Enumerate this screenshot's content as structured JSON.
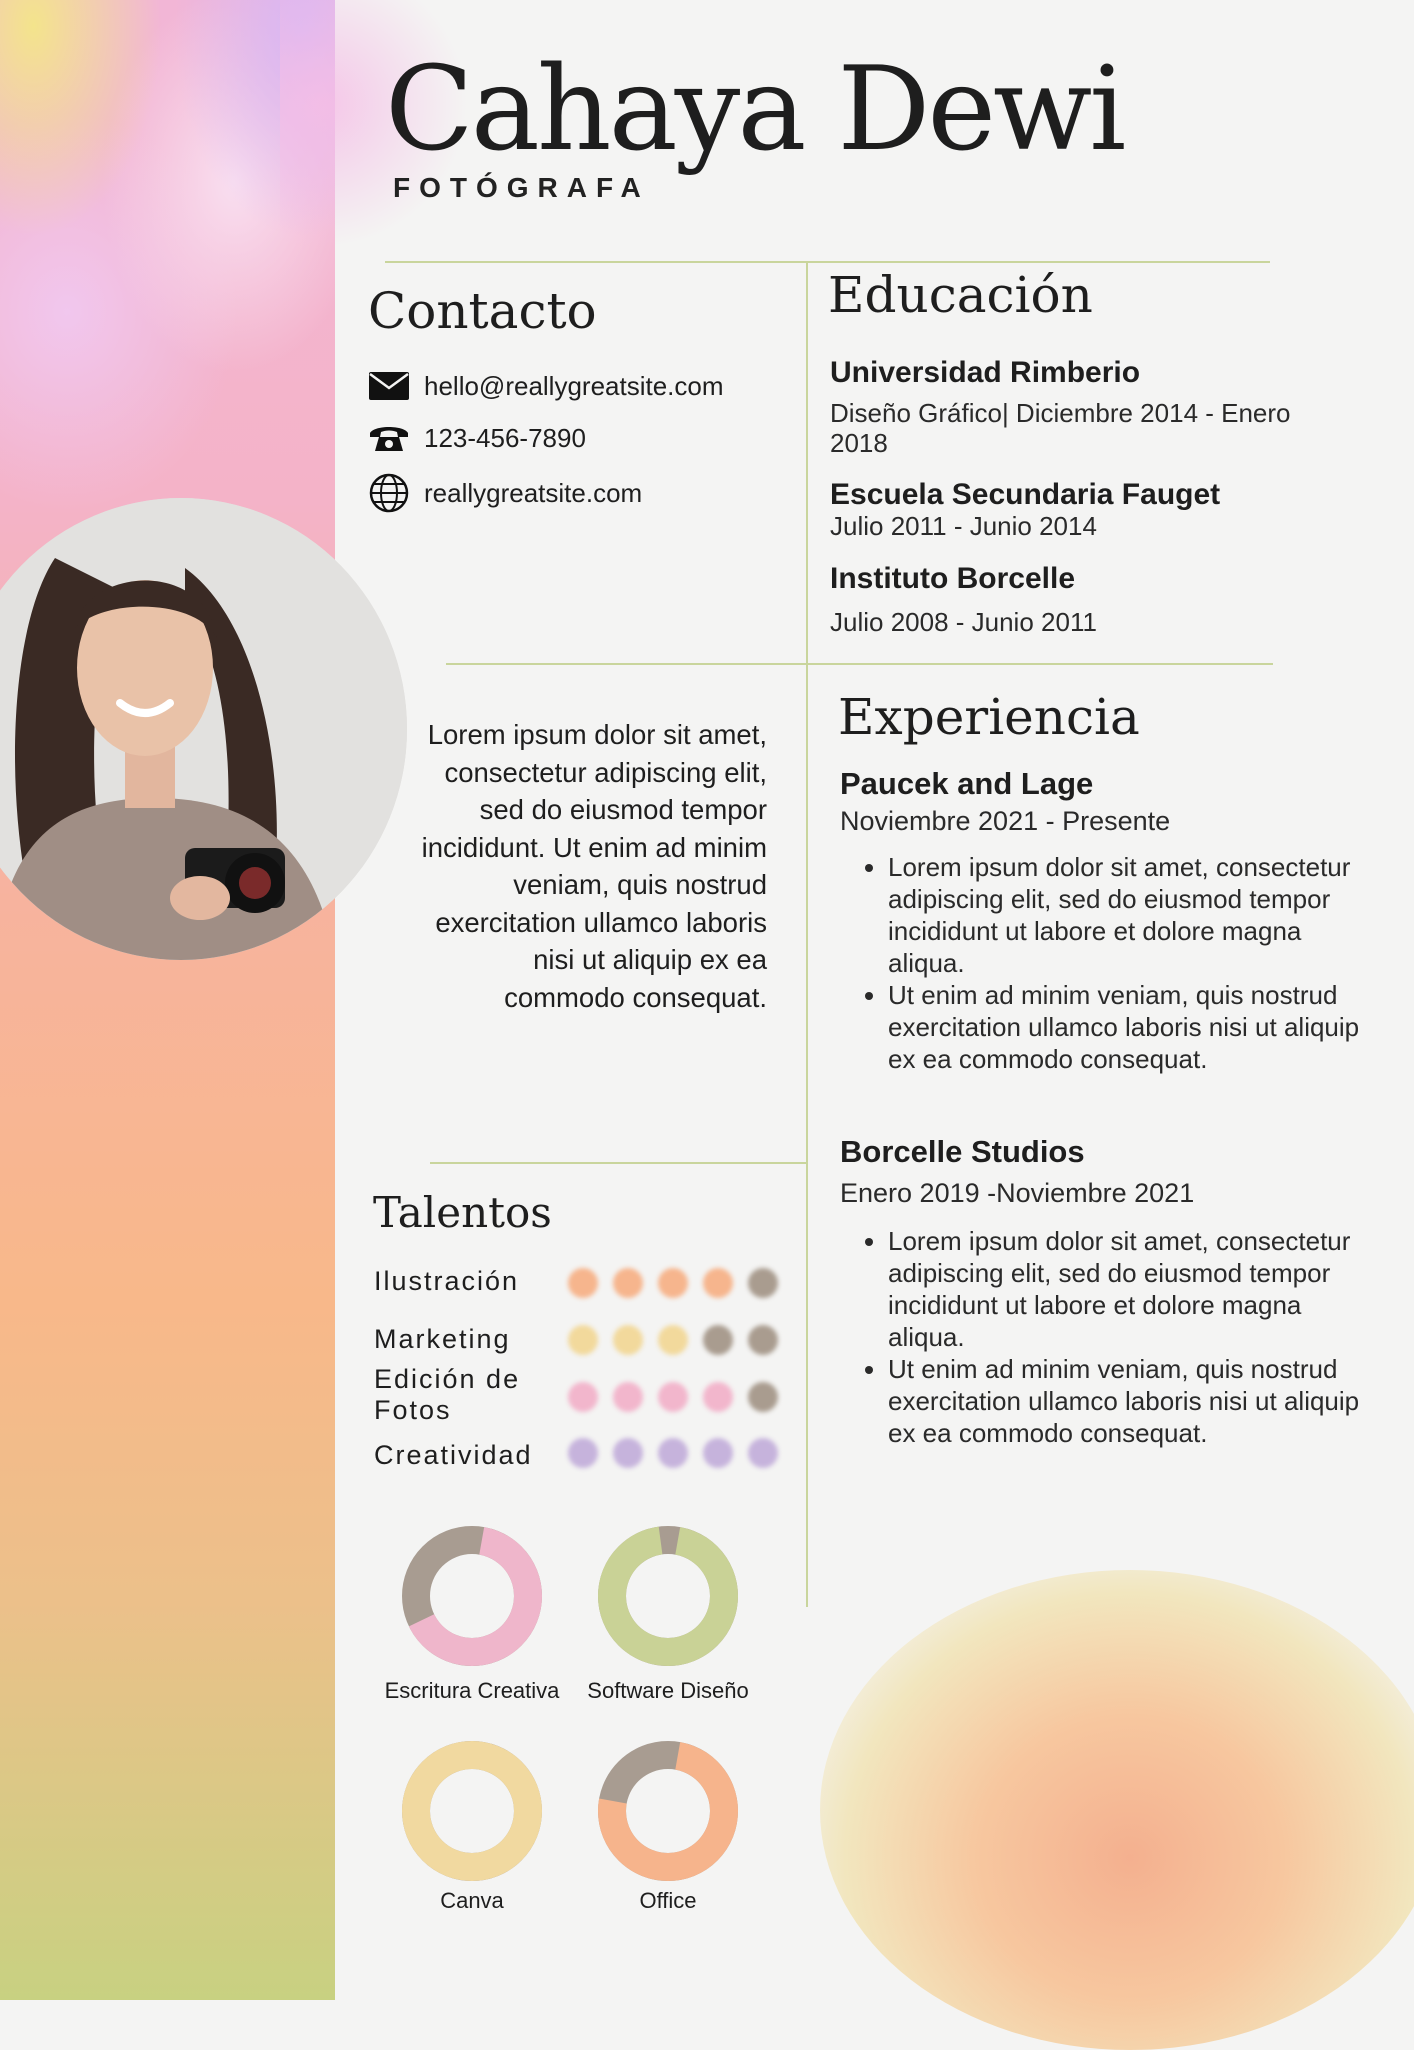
{
  "header": {
    "name": "Cahaya Dewi",
    "role": "FOTÓGRAFA"
  },
  "contact": {
    "title": "Contacto",
    "email": "hello@reallygreatsite.com",
    "phone": "123-456-7890",
    "website": "reallygreatsite.com",
    "icons": [
      "mail-icon",
      "phone-icon",
      "globe-icon"
    ]
  },
  "education": {
    "title": "Educación",
    "items": [
      {
        "school": "Universidad Rimberio",
        "detail": "Diseño Gráfico| Diciembre 2014 - Enero 2018"
      },
      {
        "school": "Escuela Secundaria Fauget",
        "detail": "Julio 2011 - Junio 2014"
      },
      {
        "school": "Instituto Borcelle",
        "detail": "Julio 2008 - Junio 2011"
      }
    ]
  },
  "about": {
    "text": "Lorem ipsum dolor sit amet, consectetur adipiscing elit, sed do eiusmod tempor incididunt. Ut enim ad minim veniam, quis nostrud exercitation ullamco laboris nisi ut aliquip ex ea commodo consequat."
  },
  "experience": {
    "title": "Experiencia",
    "jobs": [
      {
        "company": "Paucek and Lage",
        "dates": "Noviembre 2021 - Presente",
        "bullets": [
          "Lorem ipsum dolor sit amet, consectetur adipiscing elit, sed do eiusmod tempor incididunt ut labore et dolore magna aliqua.",
          "Ut enim ad minim veniam, quis nostrud exercitation ullamco laboris nisi ut aliquip ex ea commodo consequat."
        ]
      },
      {
        "company": "Borcelle Studios",
        "dates": "Enero 2019 -Noviembre 2021",
        "bullets": [
          "Lorem ipsum dolor sit amet, consectetur adipiscing elit, sed do eiusmod tempor incididunt ut labore et dolore magna aliqua.",
          "Ut enim ad minim veniam, quis nostrud exercitation ullamco laboris nisi ut aliquip ex ea commodo consequat."
        ]
      }
    ]
  },
  "talents": {
    "title": "Talentos",
    "dot_empty_color": "#a99c8f",
    "skills": [
      {
        "name": "Ilustración",
        "level": 4,
        "max": 5,
        "color": "#f6b58d"
      },
      {
        "name": "Marketing",
        "level": 3,
        "max": 5,
        "color": "#f2d99c"
      },
      {
        "name": "Edición de Fotos",
        "level": 4,
        "max": 5,
        "color": "#f2b6cc"
      },
      {
        "name": "Creatividad",
        "level": 5,
        "max": 5,
        "color": "#c6b3dc"
      }
    ]
  },
  "tools": {
    "track_color": "#a89c91",
    "items": [
      {
        "name": "Escritura Creativa",
        "fraction": 0.65,
        "color": "#efb6cb"
      },
      {
        "name": "Software Diseño",
        "fraction": 0.95,
        "color": "#c9d296"
      },
      {
        "name": "Canva",
        "fraction": 1.0,
        "color": "#f1d9a0"
      },
      {
        "name": "Office",
        "fraction": 0.75,
        "color": "#f6b48c"
      }
    ]
  }
}
